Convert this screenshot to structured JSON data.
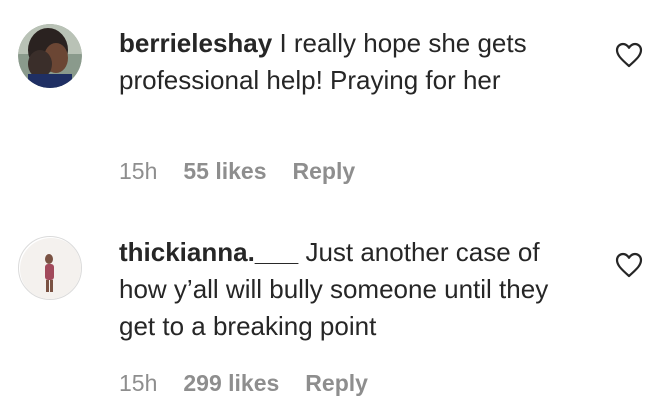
{
  "comments": [
    {
      "username": "berrieleshay",
      "text": "I really hope she gets professional help! Praying for her",
      "time": "15h",
      "likes": "55 likes",
      "reply": "Reply",
      "avatar_icon": "profile-photo",
      "like_icon": "heart-outline-icon"
    },
    {
      "username": "thickianna.___",
      "text": "Just another case of how y’all will bully someone until they get to a breaking point",
      "time": "15h",
      "likes": "299 likes",
      "reply": "Reply",
      "avatar_icon": "profile-photo",
      "like_icon": "heart-outline-icon"
    }
  ]
}
